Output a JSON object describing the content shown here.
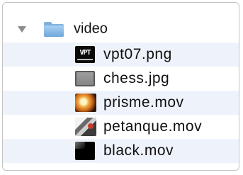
{
  "tree": {
    "folder": {
      "name": "video",
      "icon": "folder-icon",
      "expanded": true,
      "disclosure_icon": "disclosure-triangle-down-icon",
      "color": "#86b8e6"
    },
    "files": [
      {
        "name": "vpt07.png",
        "icon": "vpt-thumbnail-icon",
        "thumb_text": "VPT"
      },
      {
        "name": "chess.jpg",
        "icon": "chess-thumbnail-icon"
      },
      {
        "name": "prisme.mov",
        "icon": "prisme-thumbnail-icon"
      },
      {
        "name": "petanque.mov",
        "icon": "petanque-thumbnail-icon"
      },
      {
        "name": "black.mov",
        "icon": "black-thumbnail-icon"
      }
    ],
    "alternate_row_color": "#eef3fb"
  }
}
